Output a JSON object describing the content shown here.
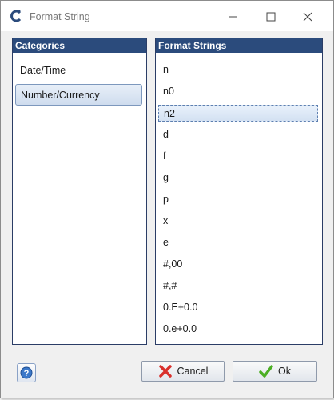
{
  "window": {
    "title": "Format String"
  },
  "categories": {
    "header": "Categories",
    "items": [
      "Date/Time",
      "Number/Currency"
    ],
    "selected": "Number/Currency"
  },
  "formats": {
    "header": "Format Strings",
    "items": [
      "n",
      "n0",
      "n2",
      "d",
      "f",
      "g",
      "p",
      "x",
      "e",
      "#,00",
      "#,#",
      "0.E+0.0",
      "0.e+0.0"
    ],
    "selected": "n2"
  },
  "buttons": {
    "cancel": "Cancel",
    "ok": "Ok"
  },
  "colors": {
    "header_bg": "#2b4b7c",
    "cancel_icon": "#d9302c",
    "ok_icon": "#4caf24",
    "help_icon": "#3b78c9"
  },
  "icons": [
    "app-c-icon",
    "minimize-icon",
    "maximize-icon",
    "close-icon",
    "help-icon",
    "cancel-x-icon",
    "ok-check-icon"
  ]
}
